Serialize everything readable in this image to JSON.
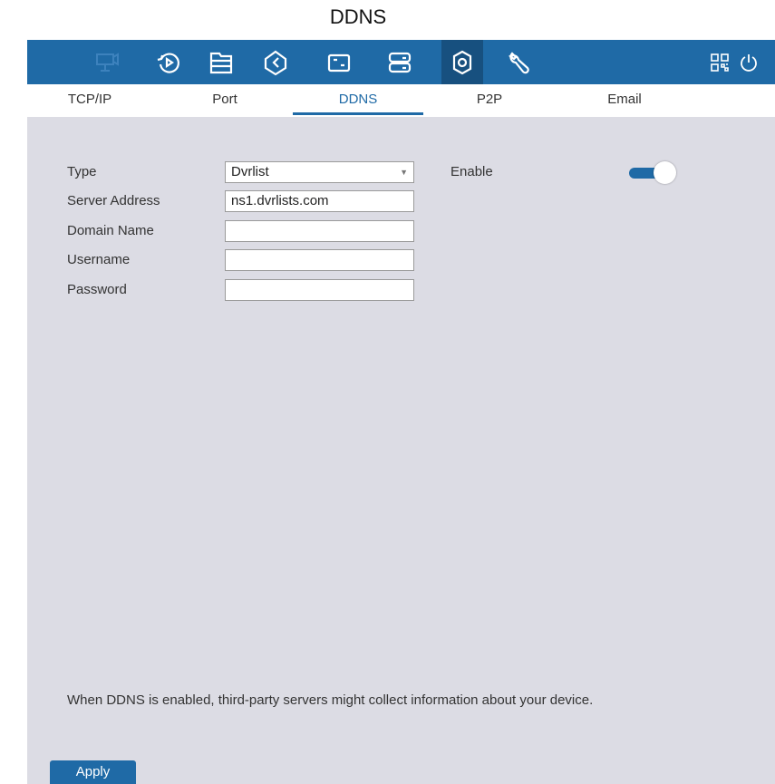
{
  "page": {
    "title": "DDNS"
  },
  "toolbar": {
    "accent": "#1f6aa6",
    "icons": [
      "camera-icon",
      "playback-icon",
      "files-icon",
      "ai-icon",
      "channel-icon",
      "storage-icon",
      "settings-icon",
      "maintenance-icon",
      "qr-code-icon",
      "power-icon"
    ],
    "active_icon": "settings-icon"
  },
  "tabs": [
    {
      "label": "TCP/IP"
    },
    {
      "label": "Port"
    },
    {
      "label": "DDNS",
      "active": true
    },
    {
      "label": "P2P"
    },
    {
      "label": "Email"
    }
  ],
  "form": {
    "type": {
      "label": "Type",
      "value": "Dvrlist"
    },
    "server_address": {
      "label": "Server Address",
      "value": "ns1.dvrlists.com"
    },
    "domain_name": {
      "label": "Domain Name",
      "value": ""
    },
    "username": {
      "label": "Username",
      "value": ""
    },
    "password": {
      "label": "Password",
      "value": ""
    },
    "enable": {
      "label": "Enable",
      "on": true
    }
  },
  "notice": "When DDNS is enabled, third-party servers might collect information about your device.",
  "apply_label": "Apply"
}
